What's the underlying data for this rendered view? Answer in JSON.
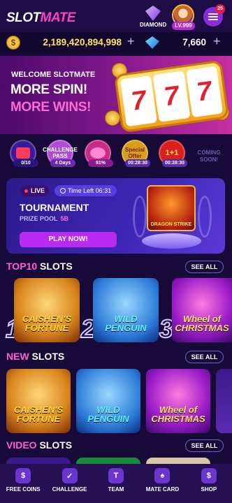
{
  "header": {
    "logo_main": "SLOT",
    "logo_accent": "MATE",
    "diamond_label": "DIAMOND",
    "level": "LV.999",
    "menu_badge": "25"
  },
  "balance": {
    "coins": "2,189,420,894,998",
    "gems": "7,660",
    "plus": "+"
  },
  "banner": {
    "welcome": "WELCOME SLOTMATE",
    "line1": "MORE SPIN!",
    "line2": "MORE WINS!",
    "reels": [
      "7",
      "7",
      "7"
    ]
  },
  "features": [
    {
      "label": "",
      "tag": "0/10",
      "icon": "video-icon"
    },
    {
      "label": "CHALLENGE PASS",
      "tag": "4 Days",
      "icon": "challenge-pass-icon"
    },
    {
      "label": "",
      "tag": "91%",
      "icon": "piggy-bank-icon"
    },
    {
      "label": "Special Offer",
      "tag": "00:28:30",
      "icon": "special-offer-icon"
    },
    {
      "label": "1+1",
      "tag": "00:28:30",
      "icon": "gift-box-icon"
    }
  ],
  "coming_soon": "COMING SOON!",
  "tournament": {
    "live": "LIVE",
    "time_left": "Time Left 06:31",
    "title": "TOURNAMENT",
    "prize_label": "PRIZE POOL",
    "prize_value": "5B",
    "play": "PLAY NOW!",
    "game": "DRAGON STRIKE"
  },
  "sections": {
    "top10_a": "TOP10",
    "top10_b": " SLOTS",
    "new_a": "NEW",
    "new_b": " SLOTS",
    "video_a": "VIDEO",
    "video_b": " SLOTS",
    "see_all": "SEE ALL"
  },
  "top10": [
    {
      "rank": "1",
      "title": "CAISHEN'S FORTUNE"
    },
    {
      "rank": "2",
      "title": "WILD PENGUIN"
    },
    {
      "rank": "3",
      "title": "Wheel of CHRISTMAS"
    }
  ],
  "new_slots": [
    {
      "title": "CAISHEN'S FORTUNE"
    },
    {
      "title": "WILD PENGUIN"
    },
    {
      "title": "Wheel of CHRISTMAS"
    }
  ],
  "nav": [
    {
      "label": "FREE COINS",
      "icon": "dollar-coin-icon",
      "glyph": "$"
    },
    {
      "label": "CHALLENGE",
      "icon": "checklist-icon",
      "glyph": "✓"
    },
    {
      "label": "TEAM",
      "icon": "team-t-icon",
      "glyph": "T"
    },
    {
      "label": "MATE CARD",
      "icon": "cards-icon",
      "glyph": "♠"
    },
    {
      "label": "SHOP",
      "icon": "shopping-bag-icon",
      "glyph": "$"
    }
  ],
  "colors": {
    "background": "#170a38",
    "accent_pink": "#ff5fd2",
    "accent_purple": "#b92bf0",
    "coin_yellow": "#ffe066"
  }
}
